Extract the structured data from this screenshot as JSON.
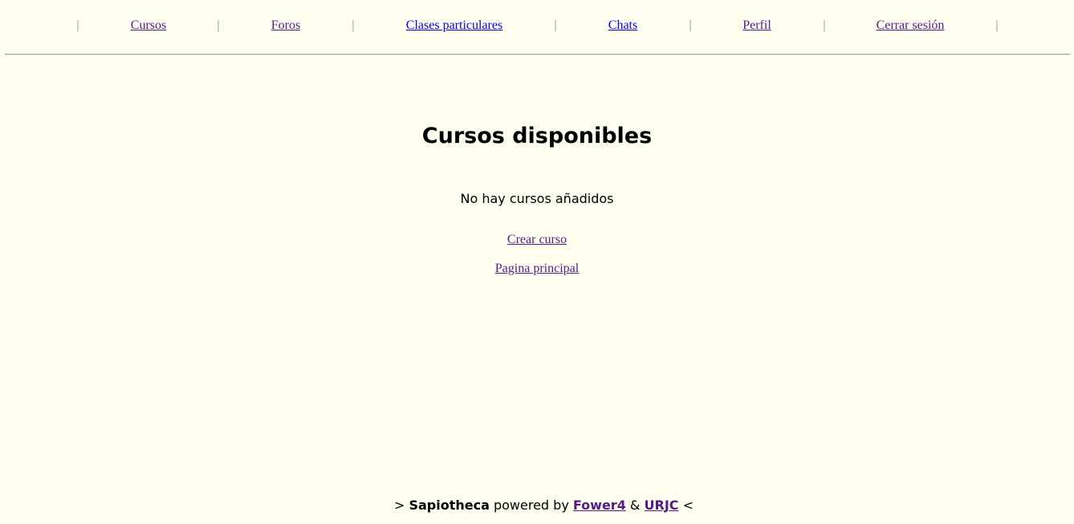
{
  "nav": {
    "separator": "|",
    "items": [
      {
        "label": "Cursos",
        "visited": true
      },
      {
        "label": "Foros",
        "visited": true
      },
      {
        "label": "Clases particulares",
        "visited": false
      },
      {
        "label": "Chats",
        "visited": false
      },
      {
        "label": "Perfil",
        "visited": true
      },
      {
        "label": "Cerrar sesión",
        "visited": true
      }
    ]
  },
  "main": {
    "title": "Cursos disponibles",
    "empty_message": "No hay cursos añadidos",
    "create_course_link": "Crear curso",
    "home_link": "Pagina principal"
  },
  "footer": {
    "prefix": ">",
    "brand": "Sapiotheca",
    "powered_by": "powered by",
    "link1": "Fower4",
    "amp": "&",
    "link2": "URJC",
    "suffix": "<"
  },
  "colors": {
    "background": "#fffff0",
    "link": "#0000ee",
    "visited_link": "#551a8b",
    "separator": "#8c8c8c"
  }
}
